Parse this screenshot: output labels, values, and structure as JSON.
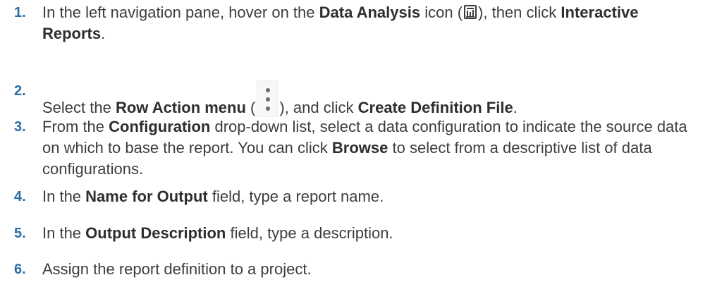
{
  "steps": [
    {
      "number": "1.",
      "parts": {
        "a": "In the left navigation pane, hover on the ",
        "b": "Data Analysis",
        "c": " icon (",
        "icon": "data-analysis-icon",
        "d": "), then click ",
        "e": "Interactive Reports",
        "f": "."
      }
    },
    {
      "number": "2.",
      "parts": {
        "a": "Select the ",
        "b": "Row Action menu",
        "c": " (",
        "icon": "row-action-menu-icon",
        "d": "), and click ",
        "e": "Create Definition File",
        "f": "."
      }
    },
    {
      "number": "3.",
      "parts": {
        "a": "From the ",
        "b": "Configuration",
        "c": " drop-down list, select a data configuration to indicate the source data on which to base the report. You can click ",
        "d": "Browse",
        "e": " to select from a descriptive list of data configurations."
      }
    },
    {
      "number": "4.",
      "parts": {
        "a": "In the ",
        "b": "Name for Output",
        "c": " field, type a report name."
      }
    },
    {
      "number": "5.",
      "parts": {
        "a": "In the ",
        "b": "Output Description",
        "c": " field, type a description."
      }
    },
    {
      "number": "6.",
      "parts": {
        "a": "Assign the report definition to a project."
      }
    }
  ]
}
